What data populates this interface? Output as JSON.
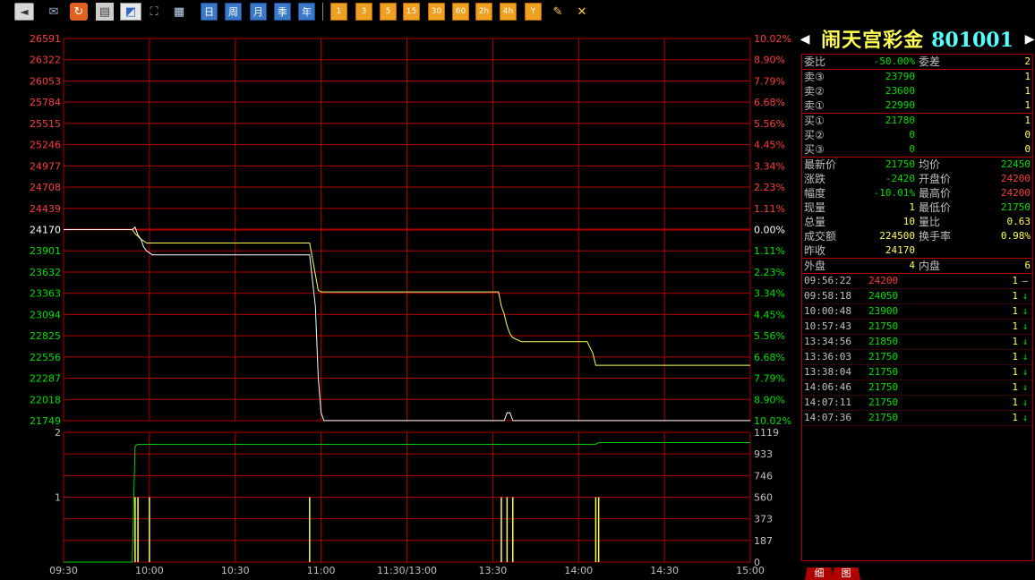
{
  "toolbar": {
    "gray_buttons": [
      "◄"
    ],
    "icons": [
      "✉",
      "↻",
      "▤",
      "◩",
      "⛶",
      "▦"
    ],
    "periods": [
      "日",
      "周",
      "月",
      "季",
      "年"
    ],
    "minutes": [
      "1",
      "3",
      "5",
      "15",
      "30",
      "60",
      "2h",
      "4h"
    ],
    "tools": [
      "Y",
      "✎",
      "✕"
    ]
  },
  "stock": {
    "name": "闹天宫彩金",
    "code": "801001",
    "prev_arrow": "◀",
    "next_arrow": "▶"
  },
  "colors": {
    "up": "#ff3c3c",
    "down": "#00e000",
    "neutral": "#c0c0c0",
    "yellow": "#ffff54",
    "grid": "#b00000",
    "price_line": "#ffffff",
    "avg_line": "#ffff54",
    "volume": "#ffff54",
    "open_interest": "#00d000"
  },
  "order_book": {
    "ratio": {
      "label": "委比",
      "value": "-50.00%",
      "diff_label": "委差",
      "diff_value": "2"
    },
    "asks": [
      {
        "label": "卖③",
        "price": "23790",
        "vol": "1"
      },
      {
        "label": "卖②",
        "price": "23600",
        "vol": "1"
      },
      {
        "label": "卖①",
        "price": "22990",
        "vol": "1"
      }
    ],
    "bids": [
      {
        "label": "买①",
        "price": "21780",
        "vol": "1"
      },
      {
        "label": "买②",
        "price": "0",
        "vol": "0"
      },
      {
        "label": "买③",
        "price": "0",
        "vol": "0"
      }
    ]
  },
  "stats": [
    {
      "l1": "最新价",
      "v1": "21750",
      "c1": "down",
      "l2": "均价",
      "v2": "22450",
      "c2": "down"
    },
    {
      "l1": "涨跌",
      "v1": "-2420",
      "c1": "down",
      "l2": "开盘价",
      "v2": "24200",
      "c2": "up"
    },
    {
      "l1": "幅度",
      "v1": "-10.01%",
      "c1": "down",
      "l2": "最高价",
      "v2": "24200",
      "c2": "up"
    },
    {
      "l1": "现量",
      "v1": "1",
      "c1": "yellow",
      "l2": "最低价",
      "v2": "21750",
      "c2": "down"
    },
    {
      "l1": "总量",
      "v1": "10",
      "c1": "yellow",
      "l2": "量比",
      "v2": "0.63",
      "c2": "yellow"
    },
    {
      "l1": "成交额",
      "v1": "224500",
      "c1": "yellow",
      "l2": "换手率",
      "v2": "0.98%",
      "c2": "yellow"
    },
    {
      "l1": "昨收",
      "v1": "24170",
      "c1": "yellow",
      "l2": "",
      "v2": "",
      "c2": "yellow"
    }
  ],
  "outer_inner": {
    "outer_label": "外盘",
    "outer": "4",
    "inner_label": "内盘",
    "inner": "6"
  },
  "ticks": [
    {
      "time": "09:56:22",
      "price": "24200",
      "pc": "up",
      "qty": "1",
      "dir": "–"
    },
    {
      "time": "09:58:18",
      "price": "24050",
      "pc": "down",
      "qty": "1",
      "dir": "↓"
    },
    {
      "time": "10:00:48",
      "price": "23900",
      "pc": "down",
      "qty": "1",
      "dir": "↓"
    },
    {
      "time": "10:57:43",
      "price": "21750",
      "pc": "down",
      "qty": "1",
      "dir": "↓"
    },
    {
      "time": "13:34:56",
      "price": "21850",
      "pc": "down",
      "qty": "1",
      "dir": "↓"
    },
    {
      "time": "13:36:03",
      "price": "21750",
      "pc": "down",
      "qty": "1",
      "dir": "↓"
    },
    {
      "time": "13:38:04",
      "price": "21750",
      "pc": "down",
      "qty": "1",
      "dir": "↓"
    },
    {
      "time": "14:06:46",
      "price": "21750",
      "pc": "down",
      "qty": "1",
      "dir": "↓"
    },
    {
      "time": "14:07:11",
      "price": "21750",
      "pc": "down",
      "qty": "1",
      "dir": "↓"
    },
    {
      "time": "14:07:36",
      "price": "21750",
      "pc": "down",
      "qty": "1",
      "dir": "↓"
    }
  ],
  "tabs": [
    "细",
    "图"
  ],
  "chart_data": {
    "type": "line",
    "price_axis": {
      "base": "24170",
      "up_ticks": [
        "26591",
        "26322",
        "26053",
        "25784",
        "25515",
        "25246",
        "24977",
        "24708",
        "24439"
      ],
      "down_ticks": [
        "23901",
        "23632",
        "23363",
        "23094",
        "22825",
        "22556",
        "22287",
        "22018",
        "21749"
      ],
      "pct_up": [
        "10.02%",
        "8.90%",
        "7.79%",
        "6.68%",
        "5.56%",
        "4.45%",
        "3.34%",
        "2.23%",
        "1.11%"
      ],
      "pct_zero": "0.00%",
      "pct_down": [
        "1.11%",
        "2.23%",
        "3.34%",
        "4.45%",
        "5.56%",
        "6.68%",
        "7.79%",
        "8.90%",
        "10.02%"
      ],
      "ylim": [
        21749,
        26591
      ]
    },
    "x_labels": [
      "09:30",
      "10:00",
      "10:30",
      "11:00",
      "11:30/13:00",
      "13:30",
      "14:00",
      "14:30",
      "15:00"
    ],
    "x_range_minutes": [
      0,
      240
    ],
    "series": [
      {
        "key": "price",
        "points": [
          [
            0,
            24170
          ],
          [
            24,
            24170
          ],
          [
            25,
            24200
          ],
          [
            26,
            24100
          ],
          [
            27,
            24050
          ],
          [
            28,
            23950
          ],
          [
            29,
            23900
          ],
          [
            31,
            23850
          ],
          [
            86,
            23850
          ],
          [
            88,
            23200
          ],
          [
            89,
            22300
          ],
          [
            90,
            21850
          ],
          [
            91,
            21750
          ],
          [
            154,
            21750
          ],
          [
            155,
            21850
          ],
          [
            156,
            21850
          ],
          [
            157,
            21750
          ],
          [
            240,
            21750
          ]
        ]
      },
      {
        "key": "avg",
        "points": [
          [
            0,
            24170
          ],
          [
            24,
            24170
          ],
          [
            25,
            24120
          ],
          [
            27,
            24050
          ],
          [
            29,
            24000
          ],
          [
            86,
            24000
          ],
          [
            88,
            23600
          ],
          [
            89,
            23400
          ],
          [
            90,
            23380
          ],
          [
            152,
            23380
          ],
          [
            153,
            23200
          ],
          [
            154,
            23100
          ],
          [
            155,
            22950
          ],
          [
            156,
            22850
          ],
          [
            157,
            22800
          ],
          [
            160,
            22750
          ],
          [
            183,
            22750
          ],
          [
            185,
            22600
          ],
          [
            186,
            22450
          ],
          [
            240,
            22450
          ]
        ]
      }
    ],
    "volume_axis": {
      "left_ticks": [
        "2",
        "1"
      ],
      "right_ticks": [
        "1119",
        "933",
        "746",
        "560",
        "373",
        "187",
        "0"
      ],
      "ylim": [
        0,
        2
      ]
    },
    "volume_bars": [
      [
        25,
        1
      ],
      [
        26,
        1
      ],
      [
        30,
        1
      ],
      [
        86,
        1
      ],
      [
        153,
        1
      ],
      [
        155,
        1
      ],
      [
        157,
        1
      ],
      [
        186,
        1
      ],
      [
        187,
        1
      ]
    ],
    "open_interest": {
      "points": [
        [
          0,
          0
        ],
        [
          24,
          0
        ],
        [
          25,
          1000
        ],
        [
          26,
          1016
        ],
        [
          186,
          1016
        ],
        [
          187,
          1030
        ],
        [
          240,
          1030
        ]
      ],
      "ylim": [
        0,
        1119
      ]
    }
  }
}
